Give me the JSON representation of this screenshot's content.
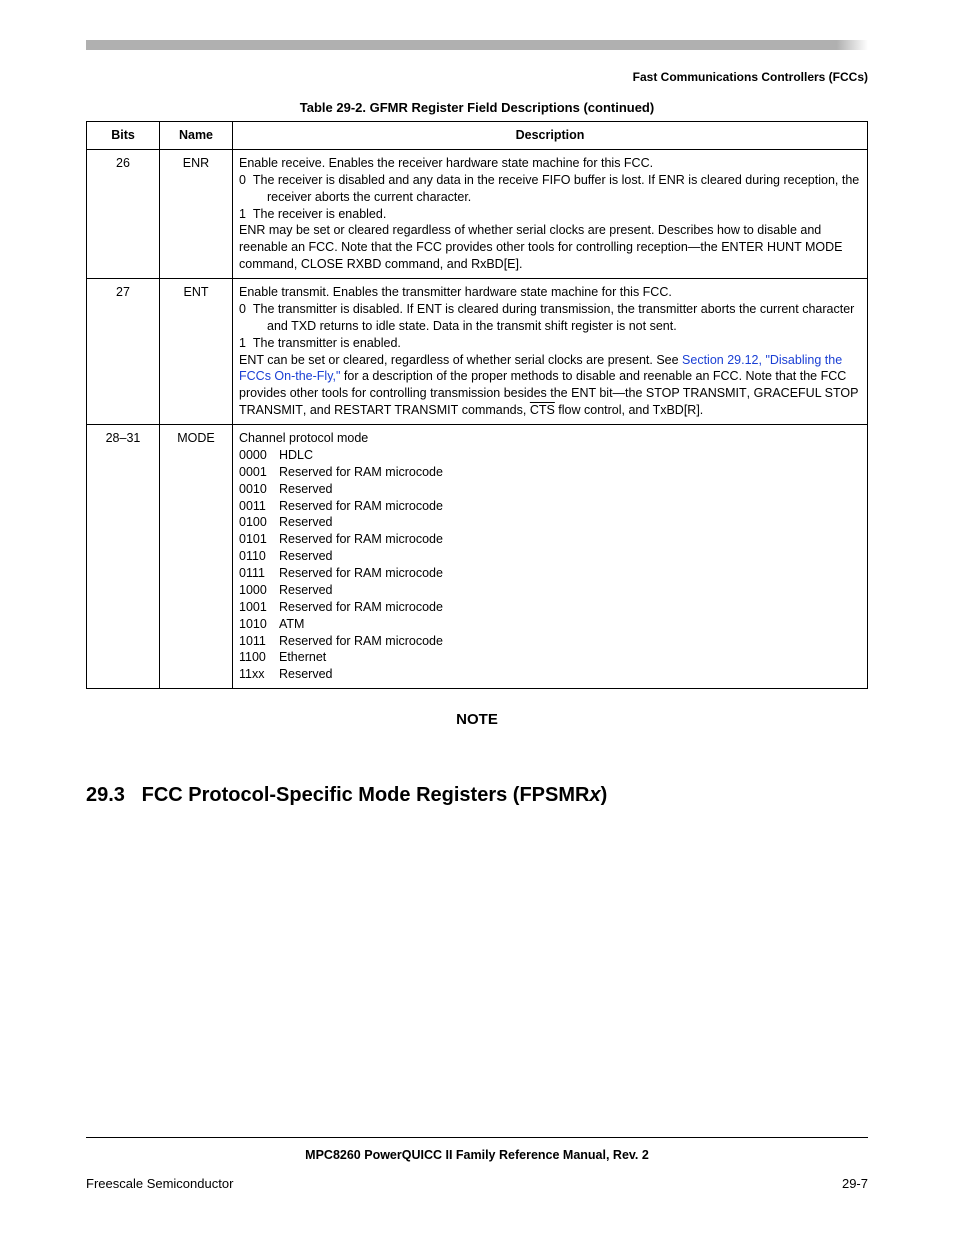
{
  "header": {
    "running_head": "Fast Communications Controllers (FCCs)"
  },
  "table": {
    "caption": "Table 29-2. GFMR Register Field Descriptions (continued)",
    "headers": {
      "bits": "Bits",
      "name": "Name",
      "desc": "Description"
    },
    "rows": [
      {
        "bits": "26",
        "name": "ENR",
        "lead": "Enable receive. Enables the receiver hardware state machine for this FCC.",
        "items": [
          {
            "k": "0",
            "v": "The receiver is disabled and any data in the receive FIFO buffer is lost. If ENR is cleared during reception, the receiver aborts the current character."
          },
          {
            "k": "1",
            "v": "The receiver is enabled."
          }
        ],
        "tail_pre": "ENR may be set or cleared regardless of whether serial clocks are present. Describes how to disable and reenable an FCC. Note that the FCC provides other tools for controlling reception—the ",
        "sc1": "ENTER HUNT MODE",
        "tail_mid1": " command, ",
        "sc2": "CLOSE RXBD",
        "tail_post": " command, and RxBD[E]."
      },
      {
        "bits": "27",
        "name": "ENT",
        "lead": "Enable transmit. Enables the transmitter hardware state machine for this FCC.",
        "items": [
          {
            "k": "0",
            "v": "The transmitter is disabled. If ENT is cleared during transmission, the transmitter aborts the current character and TXD returns to idle state. Data in the transmit shift register is not sent."
          },
          {
            "k": "1",
            "v": "The transmitter is enabled."
          }
        ],
        "tail_pre": "ENT can be set or cleared, regardless of whether serial clocks are present. See ",
        "xref": "Section 29.12, \"Disabling the FCCs On-the-Fly,\"",
        "tail_mid": " for a description of the proper methods to disable and reenable an FCC. Note that the FCC provides other tools for controlling transmission besides the ENT bit—the ",
        "sc1": "STOP TRANSMIT",
        "sep1": ", ",
        "sc2": "GRACEFUL STOP TRANSMIT",
        "sep2": ", and ",
        "sc3": "RESTART TRANSMIT",
        "tail_post_pre": " commands, ",
        "overline": "CTS",
        "tail_post_post": " flow control, and TxBD[R]."
      },
      {
        "bits": "28–31",
        "name": "MODE",
        "lead": "Channel protocol mode",
        "codes": [
          {
            "c": "0000",
            "v": "HDLC"
          },
          {
            "c": "0001",
            "v": "Reserved for RAM microcode"
          },
          {
            "c": "0010",
            "v": "Reserved"
          },
          {
            "c": "0011",
            "v": "Reserved for RAM microcode"
          },
          {
            "c": "0100",
            "v": "Reserved"
          },
          {
            "c": "0101",
            "v": "Reserved for RAM microcode"
          },
          {
            "c": "0110",
            "v": "Reserved"
          },
          {
            "c": "0111",
            "v": "Reserved for RAM microcode"
          },
          {
            "c": "1000",
            "v": "Reserved"
          },
          {
            "c": "1001",
            "v": "Reserved for RAM microcode"
          },
          {
            "c": "1010",
            "v": "ATM"
          },
          {
            "c": "1011",
            "v": "Reserved for RAM microcode"
          },
          {
            "c": "1100",
            "v": "Ethernet"
          },
          {
            "c": "11xx",
            "v": "Reserved"
          }
        ]
      }
    ]
  },
  "note": {
    "heading": "NOTE"
  },
  "section": {
    "num": "29.3",
    "title_pre": "FCC Protocol-Specific Mode Registers (FPSMR",
    "title_ital": "x",
    "title_post": ")"
  },
  "footer": {
    "manual": "MPC8260 PowerQUICC II Family Reference Manual, Rev. 2",
    "left": "Freescale Semiconductor",
    "right": "29-7"
  }
}
